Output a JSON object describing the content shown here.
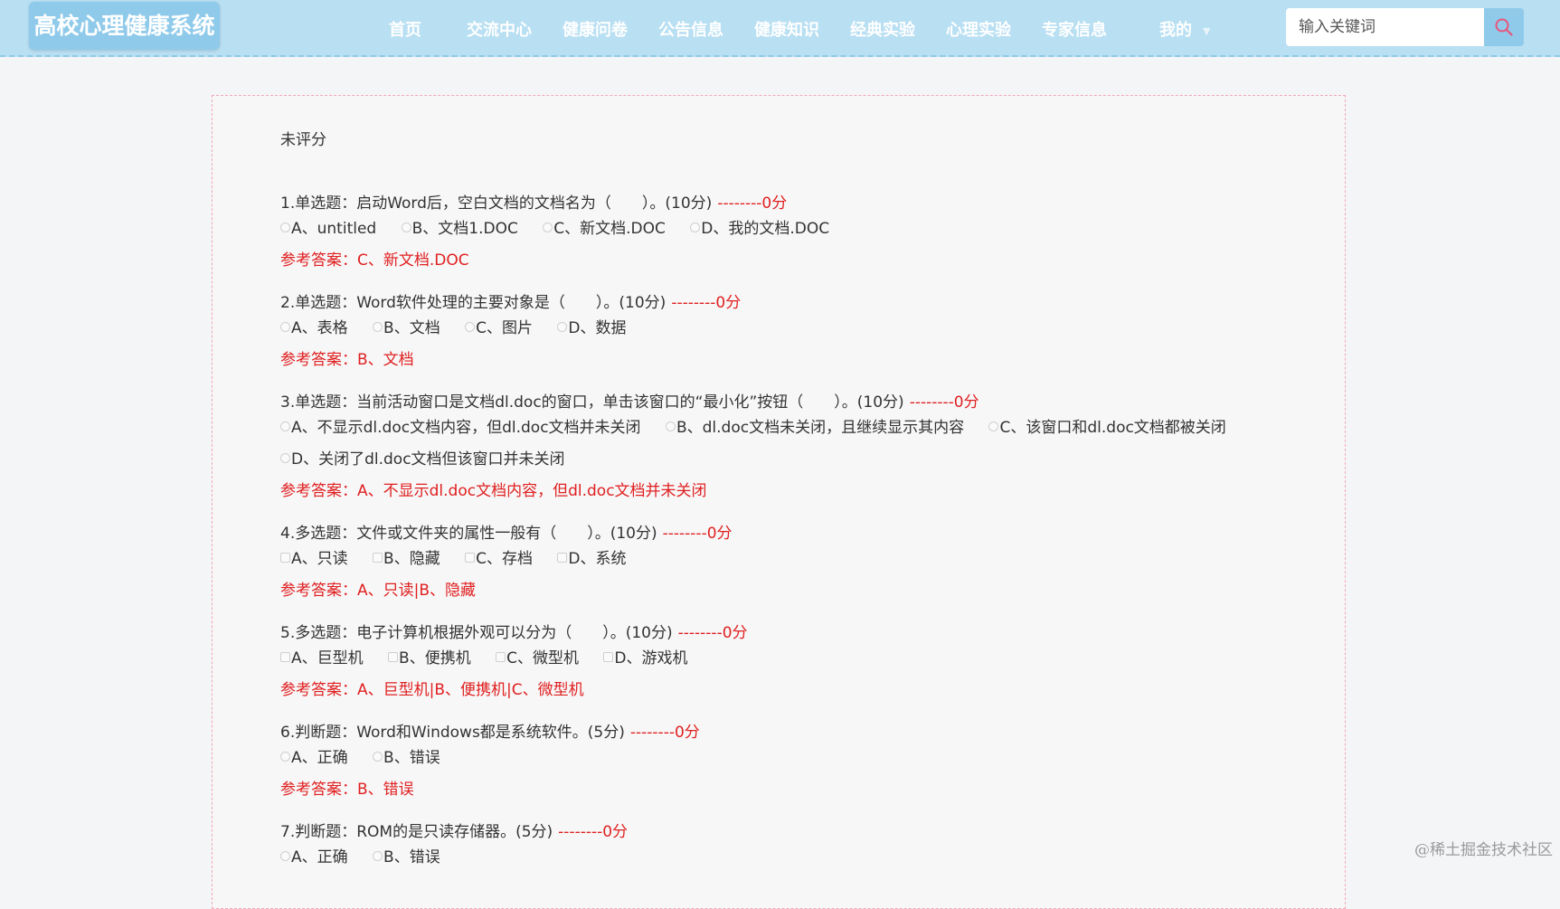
{
  "brand": {
    "title": "高校心理健康系统"
  },
  "nav": {
    "items": [
      "首页",
      "交流中心",
      "健康问卷",
      "公告信息",
      "健康知识",
      "经典实验",
      "心理实验",
      "专家信息"
    ],
    "mine_label": "我的"
  },
  "search": {
    "placeholder": "输入关键词"
  },
  "exam": {
    "status": "未评分",
    "questions": [
      {
        "title": "1.单选题：启动Word后，空白文档的文档名为（　　）。(10分)",
        "score": "--------0分",
        "kind": "radio",
        "options": [
          "A、untitled",
          "B、文档1.DOC",
          "C、新文档.DOC",
          "D、我的文档.DOC"
        ],
        "answer": "参考答案：C、新文档.DOC"
      },
      {
        "title": "2.单选题：Word软件处理的主要对象是（　　）。(10分)",
        "score": "--------0分",
        "kind": "radio",
        "options": [
          "A、表格",
          "B、文档",
          "C、图片",
          "D、数据"
        ],
        "answer": "参考答案：B、文档"
      },
      {
        "title": "3.单选题：当前活动窗口是文档dl.doc的窗口，单击该窗口的“最小化”按钮（　　）。(10分)",
        "score": "--------0分",
        "kind": "radio",
        "options": [
          "A、不显示dl.doc文档内容，但dl.doc文档并未关闭",
          "B、dl.doc文档未关闭，且继续显示其内容",
          "C、该窗口和dl.doc文档都被关闭",
          "D、关闭了dl.doc文档但该窗口并未关闭"
        ],
        "answer": "参考答案：A、不显示dl.doc文档内容，但dl.doc文档并未关闭"
      },
      {
        "title": "4.多选题：文件或文件夹的属性一般有（　　）。(10分)",
        "score": "--------0分",
        "kind": "check",
        "options": [
          "A、只读",
          "B、隐藏",
          "C、存档",
          "D、系统"
        ],
        "answer": "参考答案：A、只读|B、隐藏"
      },
      {
        "title": "5.多选题：电子计算机根据外观可以分为（　　）。(10分)",
        "score": "--------0分",
        "kind": "check",
        "options": [
          "A、巨型机",
          "B、便携机",
          "C、微型机",
          "D、游戏机"
        ],
        "answer": "参考答案：A、巨型机|B、便携机|C、微型机"
      },
      {
        "title": "6.判断题：Word和Windows都是系统软件。(5分)",
        "score": "--------0分",
        "kind": "radio",
        "options": [
          "A、正确",
          "B、错误"
        ],
        "answer": "参考答案：B、错误"
      },
      {
        "title": "7.判断题：ROM的是只读存储器。(5分)",
        "score": "--------0分",
        "kind": "radio",
        "options": [
          "A、正确",
          "B、错误"
        ],
        "answer": ""
      }
    ]
  },
  "watermark": "@稀土掘金技术社区",
  "colors": {
    "header": "#b8dff2",
    "accent": "#8fcaea",
    "answer": "#e02020"
  }
}
